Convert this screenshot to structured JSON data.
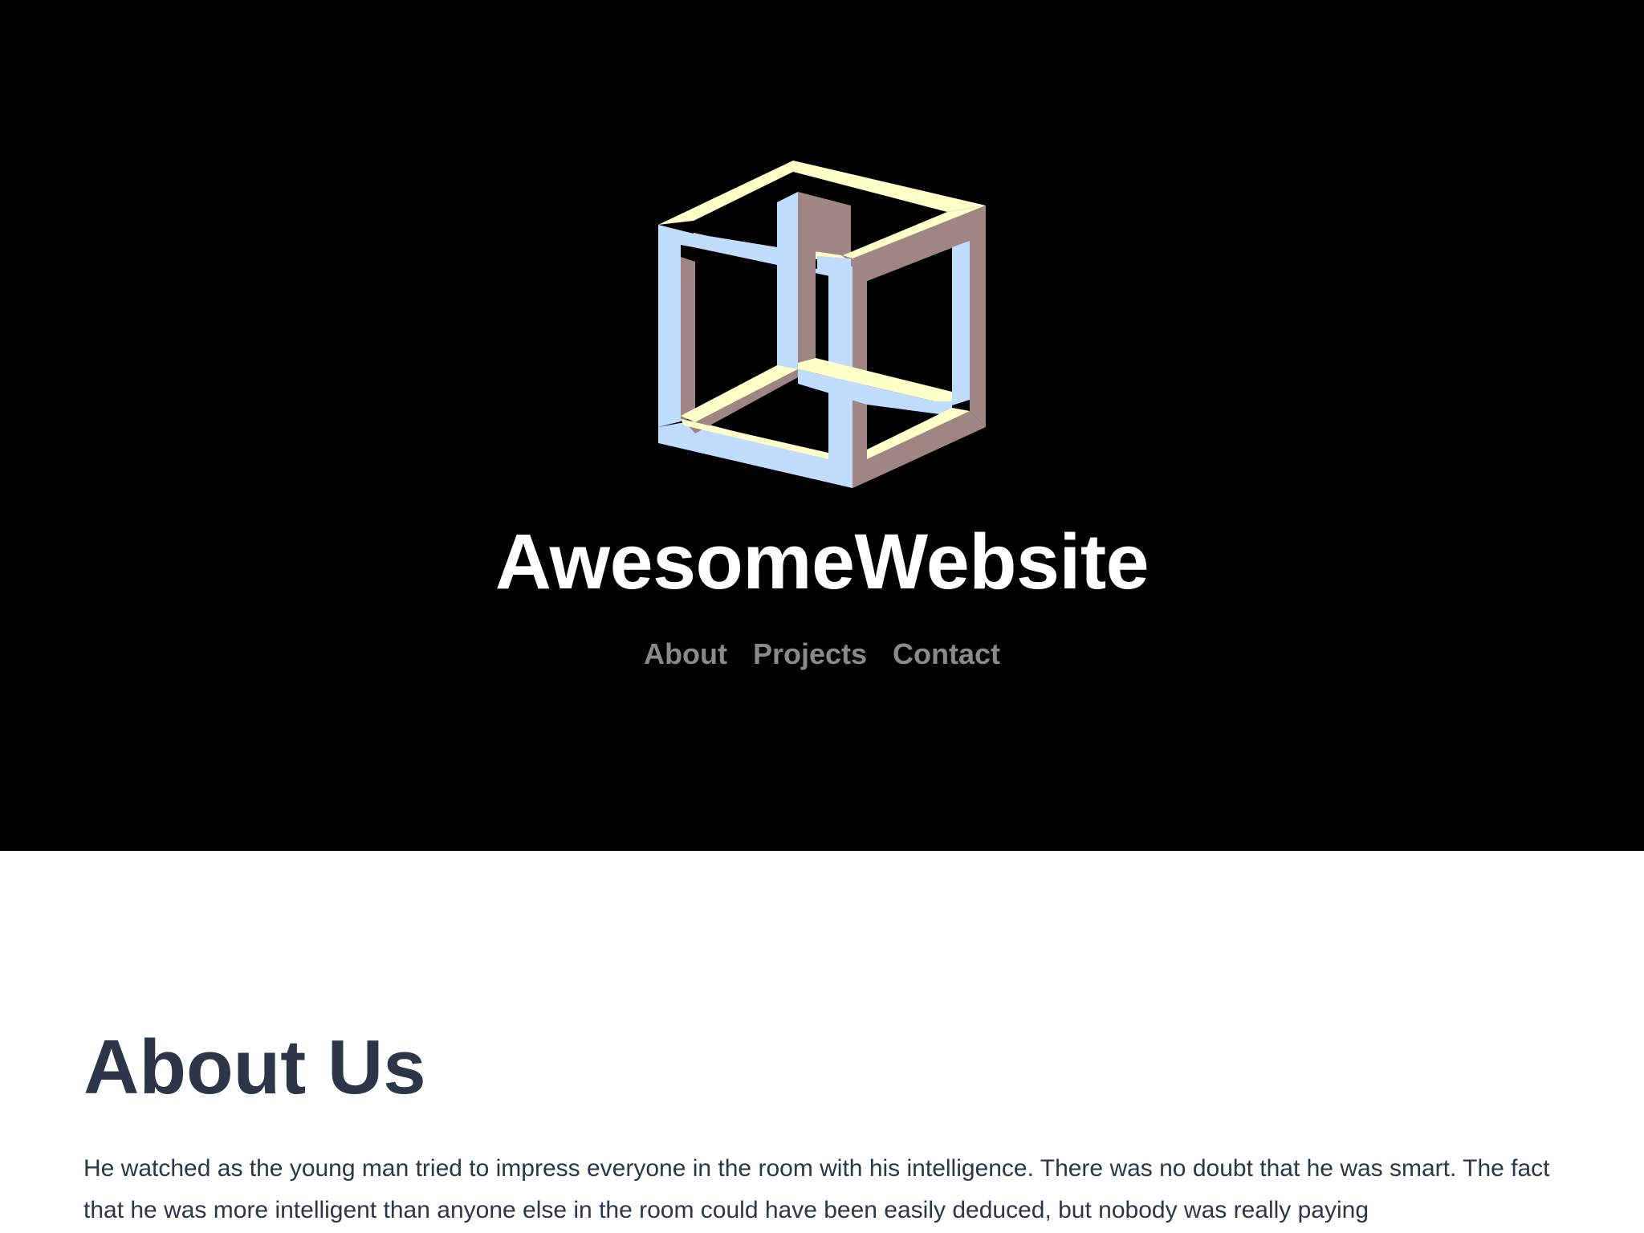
{
  "header": {
    "logo_icon": "impossible-cube-icon",
    "site_title": "AwesomeWebsite",
    "background_color": "#000000",
    "logo_colors": {
      "front": "#c0dcff",
      "top": "#ffffc8",
      "side": "#a08585"
    }
  },
  "nav": {
    "items": [
      {
        "label": "About"
      },
      {
        "label": "Projects"
      },
      {
        "label": "Contact"
      }
    ],
    "link_color": "#8a8a8a"
  },
  "about": {
    "heading": "About Us",
    "text": "He watched as the young man tried to impress everyone in the room with his intelligence. There was no doubt that he was smart. The fact that he was more intelligent than anyone else in the room could have been easily deduced, but nobody was really paying",
    "text_color": "#2d3548"
  }
}
